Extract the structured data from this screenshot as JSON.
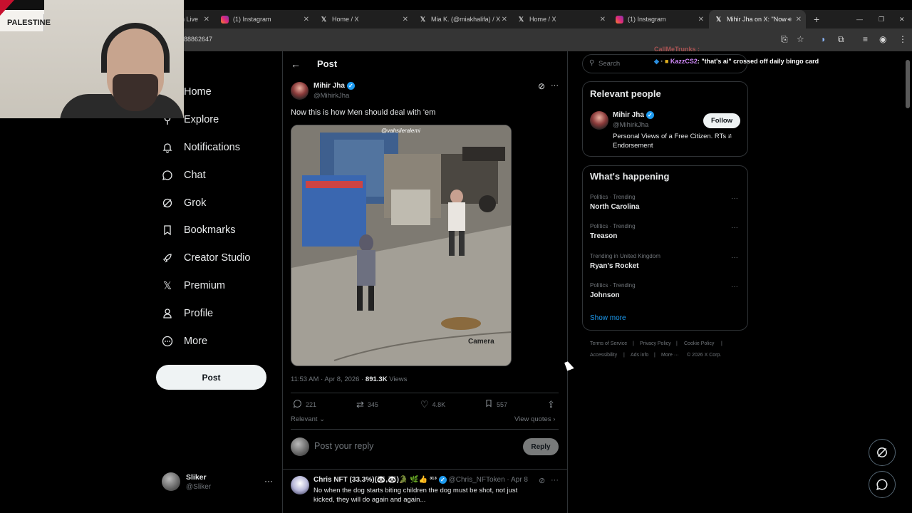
{
  "browser": {
    "tabs": [
      {
        "title": "h Live",
        "icon": "live-icon"
      },
      {
        "title": "(1) Instagram",
        "icon": "instagram-icon"
      },
      {
        "title": "Home / X",
        "icon": "x-icon"
      },
      {
        "title": "Mia K. (@miakhalifa) / X",
        "icon": "x-icon"
      },
      {
        "title": "Home / X",
        "icon": "x-icon"
      },
      {
        "title": "(1) Instagram",
        "icon": "instagram-icon"
      },
      {
        "title": "Mihir Jha on X: \"Now",
        "icon": "x-icon"
      }
    ],
    "new_tab_label": "+",
    "url": "88862647"
  },
  "webcam": {
    "flag_text": "PALESTINE"
  },
  "chat_overlay": {
    "line1_user": "CallMeTrunks",
    "line2_user": "KazzCS2",
    "line2_message": ": \"that's ai\" crossed off daily bingo card"
  },
  "nav": {
    "items": [
      {
        "label": "Home",
        "icon": "home-icon"
      },
      {
        "label": "Explore",
        "icon": "search-icon"
      },
      {
        "label": "Notifications",
        "icon": "bell-icon"
      },
      {
        "label": "Chat",
        "icon": "chat-icon"
      },
      {
        "label": "Grok",
        "icon": "grok-icon"
      },
      {
        "label": "Bookmarks",
        "icon": "bookmark-icon"
      },
      {
        "label": "Creator Studio",
        "icon": "rocket-icon"
      },
      {
        "label": "Premium",
        "icon": "x-logo-icon"
      },
      {
        "label": "Profile",
        "icon": "person-icon"
      },
      {
        "label": "More",
        "icon": "more-circle-icon"
      }
    ],
    "post_label": "Post",
    "account": {
      "name": "Sliker",
      "handle": "@Sliker"
    }
  },
  "post": {
    "header_title": "Post",
    "author_name": "Mihir Jha",
    "author_handle": "@MihirkJha",
    "text": "Now this is how Men should deal with 'em",
    "media_watermark": "@vahsileralemi",
    "media_caption": "Camera",
    "time": "11:53 AM · Apr 8, 2026 · ",
    "views_count": "891.3K",
    "views_label": " Views",
    "replies": "221",
    "reposts": "345",
    "likes": "4.8K",
    "bookmarks": "557",
    "sort_label": "Relevant",
    "view_quotes": "View quotes",
    "reply_placeholder": "Post your reply",
    "reply_button": "Reply"
  },
  "reply": {
    "name": "Chris NFT (33.3%)(🐼,🐼)🐊 🌿👍 ³¹³",
    "handle": "@Chris_NFToken · Apr 8",
    "line1": "No when the dog starts biting children the dog must be shot, not just",
    "line2": "kicked, they will do again and again..."
  },
  "sidebar": {
    "search_placeholder": "Search",
    "relevant_title": "Relevant people",
    "person": {
      "name": "Mihir Jha",
      "handle": "@MihirkJha",
      "bio_line1": "Personal Views of a Free Citizen. RTs ≠",
      "bio_line2": "Endorsement",
      "follow_label": "Follow"
    },
    "happening_title": "What's happening",
    "trends": [
      {
        "category": "Politics · Trending",
        "name": "North Carolina"
      },
      {
        "category": "Politics · Trending",
        "name": "Treason"
      },
      {
        "category": "Trending in United Kingdom",
        "name": "Ryan's Rocket"
      },
      {
        "category": "Politics · Trending",
        "name": "Johnson"
      }
    ],
    "show_more": "Show more",
    "footer": {
      "terms": "Terms of Service",
      "privacy": "Privacy Policy",
      "cookie": "Cookie Policy",
      "accessibility": "Accessibility",
      "ads": "Ads info",
      "more": "More ···",
      "copyright": "© 2026 X Corp."
    }
  },
  "colors": {
    "accent": "#1d9bf0",
    "background": "#000000",
    "border": "#2f3336",
    "muted": "#71767b"
  }
}
